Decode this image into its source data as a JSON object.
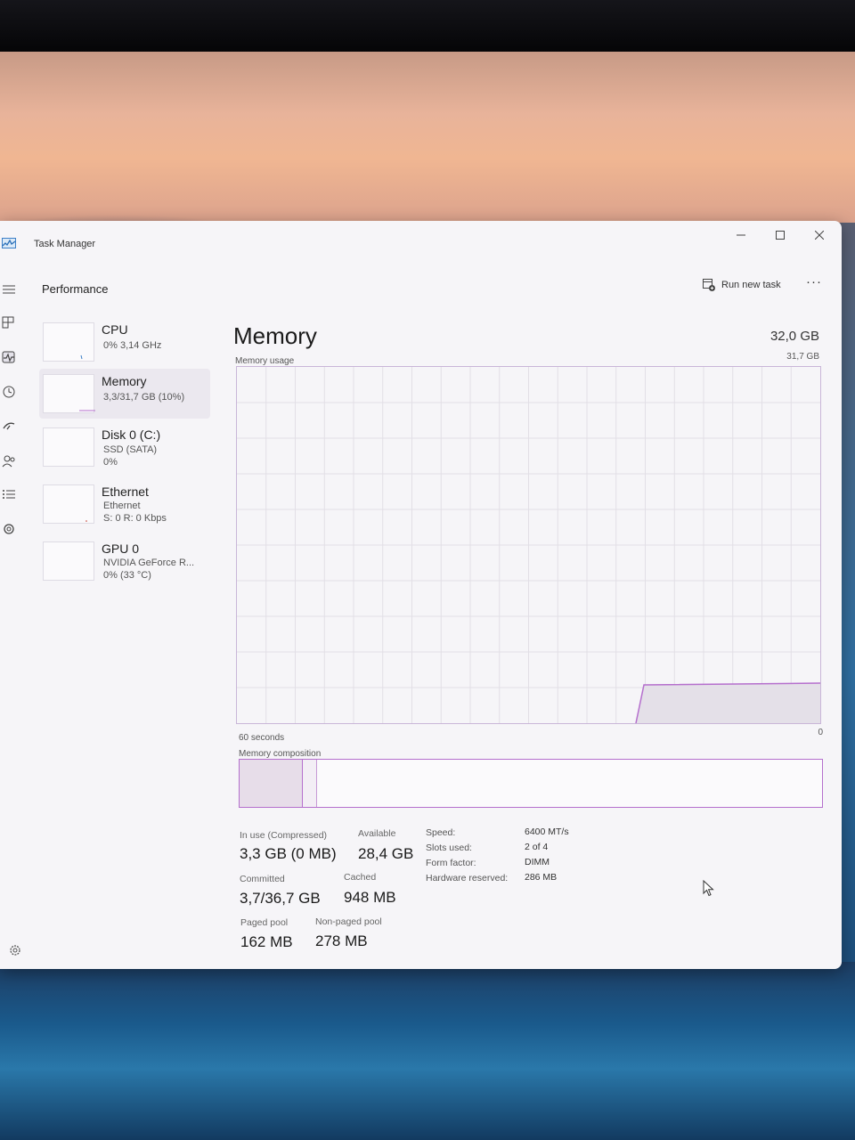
{
  "window": {
    "title": "Task Manager"
  },
  "header": {
    "section": "Performance",
    "run_new_task": "Run new task",
    "more": "···"
  },
  "sidebar": {
    "items": [
      {
        "name": "CPU",
        "line1": "0% 3,14 GHz",
        "line2": ""
      },
      {
        "name": "Memory",
        "line1": "3,3/31,7 GB (10%)",
        "line2": ""
      },
      {
        "name": "Disk 0 (C:)",
        "line1": "SSD (SATA)",
        "line2": "0%"
      },
      {
        "name": "Ethernet",
        "line1": "Ethernet",
        "line2": "S: 0 R: 0 Kbps"
      },
      {
        "name": "GPU 0",
        "line1": "NVIDIA GeForce R...",
        "line2": "0% (33 °C)"
      }
    ],
    "selected_index": 1
  },
  "memory": {
    "title": "Memory",
    "total": "32,0 GB",
    "chart": {
      "label": "Memory usage",
      "max_label": "31,7 GB",
      "time_label": "60 seconds",
      "min_label": "0"
    },
    "composition_label": "Memory composition",
    "stats": {
      "in_use_label": "In use (Compressed)",
      "in_use_value": "3,3 GB (0 MB)",
      "available_label": "Available",
      "available_value": "28,4 GB",
      "committed_label": "Committed",
      "committed_value": "3,7/36,7 GB",
      "cached_label": "Cached",
      "cached_value": "948 MB",
      "paged_label": "Paged pool",
      "paged_value": "162 MB",
      "nonpaged_label": "Non-paged pool",
      "nonpaged_value": "278 MB"
    },
    "details": [
      {
        "label": "Speed:",
        "value": "6400 MT/s"
      },
      {
        "label": "Slots used:",
        "value": "2 of 4"
      },
      {
        "label": "Form factor:",
        "value": "DIMM"
      },
      {
        "label": "Hardware reserved:",
        "value": "286 MB"
      }
    ]
  },
  "colors": {
    "memory_accent": "#b56fcd",
    "window_bg": "#f6f5f8",
    "grid": "#e2dfe6"
  }
}
